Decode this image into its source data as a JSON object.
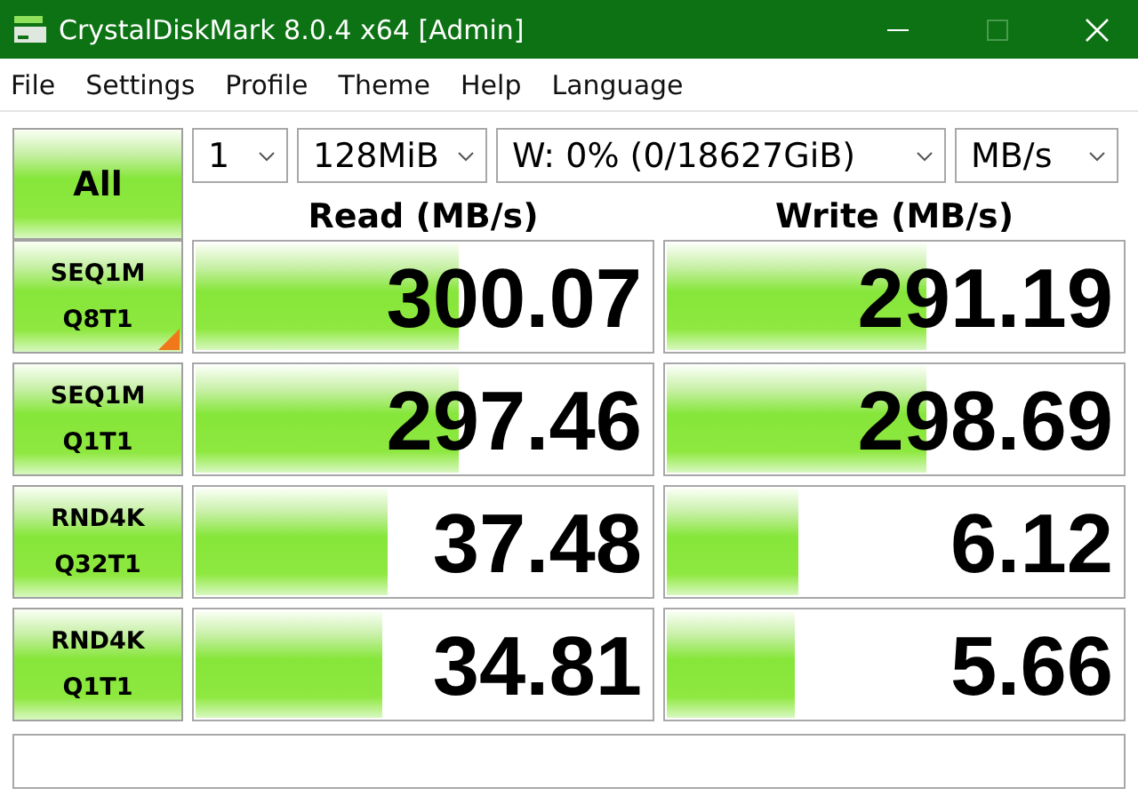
{
  "window": {
    "title": "CrystalDiskMark 8.0.4 x64 [Admin]"
  },
  "menu": [
    "File",
    "Settings",
    "Profile",
    "Theme",
    "Help",
    "Language"
  ],
  "all_button": "All",
  "selectors": [
    {
      "value": "1"
    },
    {
      "value": "128MiB"
    },
    {
      "value": "W: 0% (0/18627GiB)"
    },
    {
      "value": "MB/s"
    }
  ],
  "headers": {
    "read": "Read (MB/s)",
    "write": "Write (MB/s)"
  },
  "tests": [
    {
      "line1": "SEQ1M",
      "line2": "Q8T1",
      "marked": true,
      "read": {
        "value": "300.07",
        "level": 0.58
      },
      "write": {
        "value": "291.19",
        "level": 0.57
      }
    },
    {
      "line1": "SEQ1M",
      "line2": "Q1T1",
      "marked": false,
      "read": {
        "value": "297.46",
        "level": 0.58
      },
      "write": {
        "value": "298.69",
        "level": 0.57
      }
    },
    {
      "line1": "RND4K",
      "line2": "Q32T1",
      "marked": false,
      "read": {
        "value": "37.48",
        "level": 0.42
      },
      "write": {
        "value": "6.12",
        "level": 0.29
      }
    },
    {
      "line1": "RND4K",
      "line2": "Q1T1",
      "marked": false,
      "read": {
        "value": "34.81",
        "level": 0.41
      },
      "write": {
        "value": "5.66",
        "level": 0.28
      }
    }
  ]
}
